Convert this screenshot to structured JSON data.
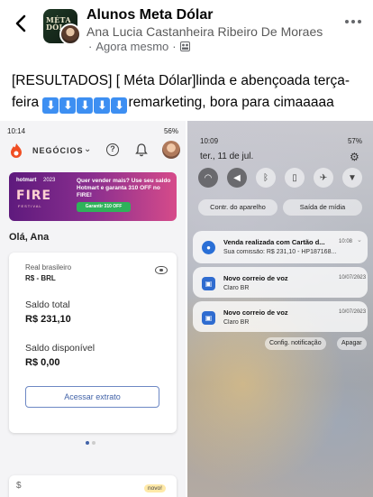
{
  "header": {
    "group_name": "Alunos Meta Dólar",
    "group_avatar_text": "MÉTA DÓL",
    "author_name": "Ana Lucia Castanheira Ribeiro De Moraes",
    "meta_prefix": "·",
    "timestamp": "Agora mesmo",
    "meta_separator": "·",
    "privacy_icon": "group-privacy-icon",
    "back_icon": "chevron-left-icon",
    "more_icon": "more-dots-icon"
  },
  "post": {
    "text_before": "[RESULTADOS] [ Méta Dólar]linda e abençoada terça-feira ",
    "arrow_emoji": "⬇",
    "arrow_count": 5,
    "text_after": "remarketing, bora para cimaaaaa"
  },
  "left_screen": {
    "status_time": "10:14",
    "status_right": "56%",
    "app_section": "NEGÓCIOS",
    "banner": {
      "brand": "hotmart",
      "year": "2023",
      "fire": "FIRE",
      "festival": "FESTIVAL",
      "promo_text": "Quer vender mais? Use seu saldo Hotmart e garanta 310 OFF no FIRE!",
      "cta": "Garantir 310 OFF"
    },
    "greeting": "Olá, Ana",
    "currency_label": "Real brasileiro",
    "currency_code": "R$ - BRL",
    "saldo_total_label": "Saldo total",
    "saldo_total_value": "R$ 231,10",
    "saldo_disponivel_label": "Saldo disponível",
    "saldo_disponivel_value": "R$ 0,00",
    "extrato_button": "Acessar extrato",
    "novo_badge": "novo!"
  },
  "right_screen": {
    "status_time": "10:09",
    "status_right": "57%",
    "date": "ter., 11 de jul.",
    "device_control": "Contr. do aparelho",
    "media_output": "Saída de mídia",
    "notifications": [
      {
        "title": "Venda realizada com Cartão d...",
        "time": "10:08",
        "body": "Sua comissão: R$ 231,10 - HP187168...",
        "icon": "hotmart-icon"
      },
      {
        "title": "Novo correio de voz",
        "time": "10/07/2023",
        "body": "Claro BR",
        "icon": "voicemail-icon"
      },
      {
        "title": "Novo correio de voz",
        "time": "10/07/2023",
        "body": "Claro BR",
        "icon": "voicemail-icon"
      }
    ],
    "notif_settings": "Config. notificação",
    "clear_all": "Apagar"
  },
  "colors": {
    "accent_blue": "#3d8ff2",
    "banner_purple": "#5e1a7d",
    "banner_green": "#2fb25a"
  }
}
